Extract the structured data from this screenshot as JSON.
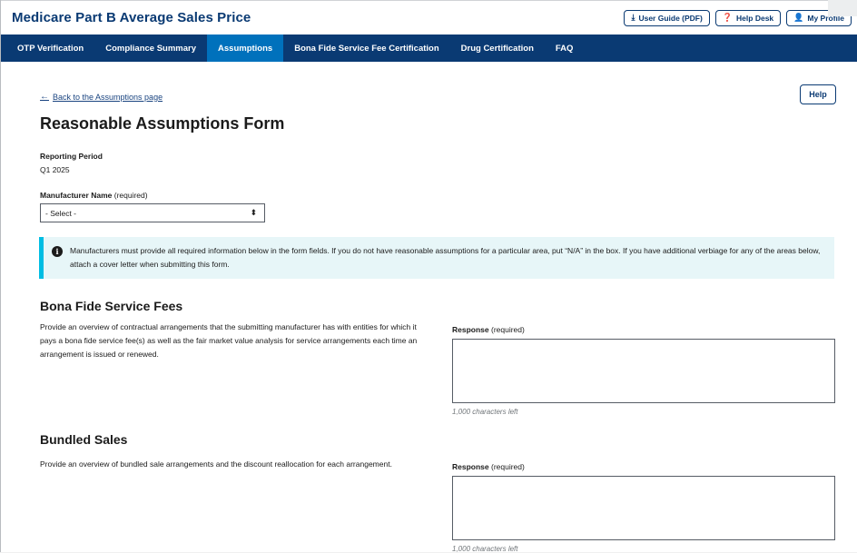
{
  "header": {
    "title": "Medicare Part B Average Sales Price",
    "buttons": [
      {
        "icon": "download-icon",
        "label": "User Guide (PDF)"
      },
      {
        "icon": "question-icon",
        "label": "Help Desk"
      },
      {
        "icon": "person-icon",
        "label": "My Profile"
      }
    ]
  },
  "nav": {
    "items": [
      {
        "label": "OTP Verification",
        "active": false
      },
      {
        "label": "Compliance Summary",
        "active": false
      },
      {
        "label": "Assumptions",
        "active": true
      },
      {
        "label": "Bona Fide Service Fee Certification",
        "active": false
      },
      {
        "label": "Drug Certification",
        "active": false
      },
      {
        "label": "FAQ",
        "active": false
      }
    ]
  },
  "main": {
    "back_link": "Back to the Assumptions page",
    "help_label": "Help",
    "page_title": "Reasonable Assumptions Form",
    "reporting_period": {
      "label": "Reporting Period",
      "value": "Q1 2025"
    },
    "manufacturer": {
      "label": "Manufacturer Name",
      "required": "(required)",
      "selected": "- Select -"
    },
    "alert": "Manufacturers must provide all required information below in the form fields. If you do not have reasonable assumptions for a particular area, put “N/A” in the box. If you have additional verbiage for any of the areas below, attach a cover letter when submitting this form.",
    "sections": [
      {
        "title": "Bona Fide Service Fees",
        "description": "Provide an overview of contractual arrangements that the submitting manufacturer has with entities for which it pays a bona fide service fee(s) as well as the fair market value analysis for service arrangements each time an arrangement is issued or renewed.",
        "response_label": "Response",
        "response_required": "(required)",
        "response_value": "",
        "chars_left": "1,000 characters left"
      },
      {
        "title": "Bundled Sales",
        "description": "Provide an overview of bundled sale arrangements and the discount reallocation for each arrangement.",
        "response_label": "Response",
        "response_required": "(required)",
        "response_value": "",
        "chars_left": "1,000 characters left"
      }
    ]
  },
  "colors": {
    "brand_navy": "#0a3a73",
    "nav_active": "#0071bc",
    "alert_bg": "#e7f6f8",
    "alert_border": "#00bde3",
    "link": "#1a4480"
  }
}
